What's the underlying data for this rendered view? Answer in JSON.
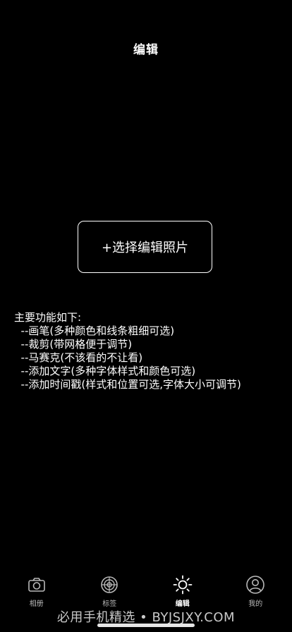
{
  "header": {
    "title": "编辑"
  },
  "main": {
    "select_button_label": "+选择编辑照片",
    "features_heading": "主要功能如下:",
    "features": [
      "  --画笔(多种颜色和线条粗细可选)",
      "  --裁剪(带网格便于调节)",
      "  --马赛克(不该看的不让看)",
      "  --添加文字(多种字体样式和颜色可选)",
      "  --添加时间戳(样式和位置可选,字体大小可调节)"
    ]
  },
  "tabbar": {
    "tabs": [
      {
        "label": "相册",
        "icon": "camera-icon"
      },
      {
        "label": "标签",
        "icon": "crosshair-icon"
      },
      {
        "label": "编辑",
        "icon": "sun-icon",
        "active": true
      },
      {
        "label": "我的",
        "icon": "user-icon"
      }
    ]
  },
  "watermark": "必用手机精选 • BYJSJXY.COM",
  "colors": {
    "background": "#000000",
    "text": "#ffffff",
    "inactive_tab": "#b8b8b8"
  }
}
